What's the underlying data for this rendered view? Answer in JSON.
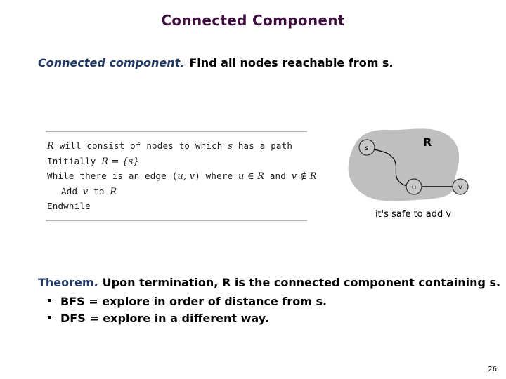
{
  "slide": {
    "title": "Connected Component",
    "page_number": "26",
    "title_color": "#3f0d3f",
    "accent_color": "#1f3864"
  },
  "lead": {
    "accent": "Connected component.",
    "text": "Find all nodes reachable from s."
  },
  "pseudocode": {
    "lines": [
      {
        "id": "l1",
        "indent": false,
        "parts": [
          "R",
          " will consist of nodes to which ",
          "s",
          " has a path"
        ]
      },
      {
        "id": "l2",
        "indent": false,
        "parts": [
          "Initially ",
          "R",
          " = {",
          "s",
          "}"
        ]
      },
      {
        "id": "l3",
        "indent": false,
        "parts": [
          "While there is an edge (",
          "u",
          ", ",
          "v",
          ") where ",
          "u",
          " ∈ ",
          "R",
          " and ",
          "v",
          " ∉ ",
          "R"
        ]
      },
      {
        "id": "l4",
        "indent": true,
        "parts": [
          "Add ",
          "v",
          " to ",
          "R"
        ]
      },
      {
        "id": "l5",
        "indent": false,
        "parts": [
          "Endwhile"
        ]
      }
    ],
    "line1_pre": "R",
    "line1_mid": " will consist of nodes to which ",
    "line1_var2": "s",
    "line1_post": " has a path",
    "line2_pre": "Initially ",
    "line2_var1": "R",
    "line2_eq": " = {",
    "line2_var2": "s",
    "line2_close": "}",
    "line3_pre": "While there is an edge (",
    "line3_u1": "u",
    "line3_comma": ", ",
    "line3_v1": "v",
    "line3_mid": ") where ",
    "line3_u2": "u",
    "line3_in": " ∈ ",
    "line3_r1": "R",
    "line3_and": " and ",
    "line3_v2": "v",
    "line3_notin": " ∉ ",
    "line3_r2": "R",
    "line4_pre": "Add ",
    "line4_v": "v",
    "line4_to": " to ",
    "line4_r": "R",
    "line5": "Endwhile"
  },
  "diagram": {
    "region_label": "R",
    "nodes": [
      {
        "id": "s",
        "label": "s"
      },
      {
        "id": "u",
        "label": "u"
      },
      {
        "id": "v",
        "label": "v"
      }
    ],
    "caption": "it's safe to add v",
    "blob_fill": "#bfbfbf",
    "node_fill": "#c8c8c8"
  },
  "theorem": {
    "accent": "Theorem.",
    "text": "Upon termination, R is the connected component containing s.",
    "bullets": [
      "BFS = explore in order of distance from s.",
      "DFS = explore in a different way."
    ]
  }
}
